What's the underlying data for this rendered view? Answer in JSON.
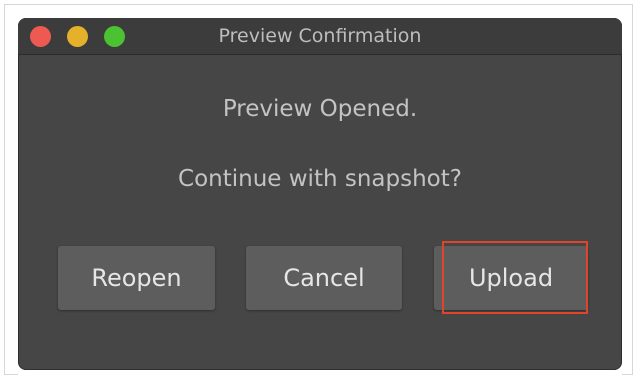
{
  "window": {
    "title": "Preview Confirmation"
  },
  "dialog": {
    "message": "Preview Opened.",
    "question": "Continue with snapshot?"
  },
  "buttons": {
    "reopen": "Reopen",
    "cancel": "Cancel",
    "upload": "Upload"
  },
  "colors": {
    "close": "#ee5a52",
    "minimize": "#e5b02a",
    "zoom": "#4bc231",
    "highlight": "#e0442a"
  }
}
